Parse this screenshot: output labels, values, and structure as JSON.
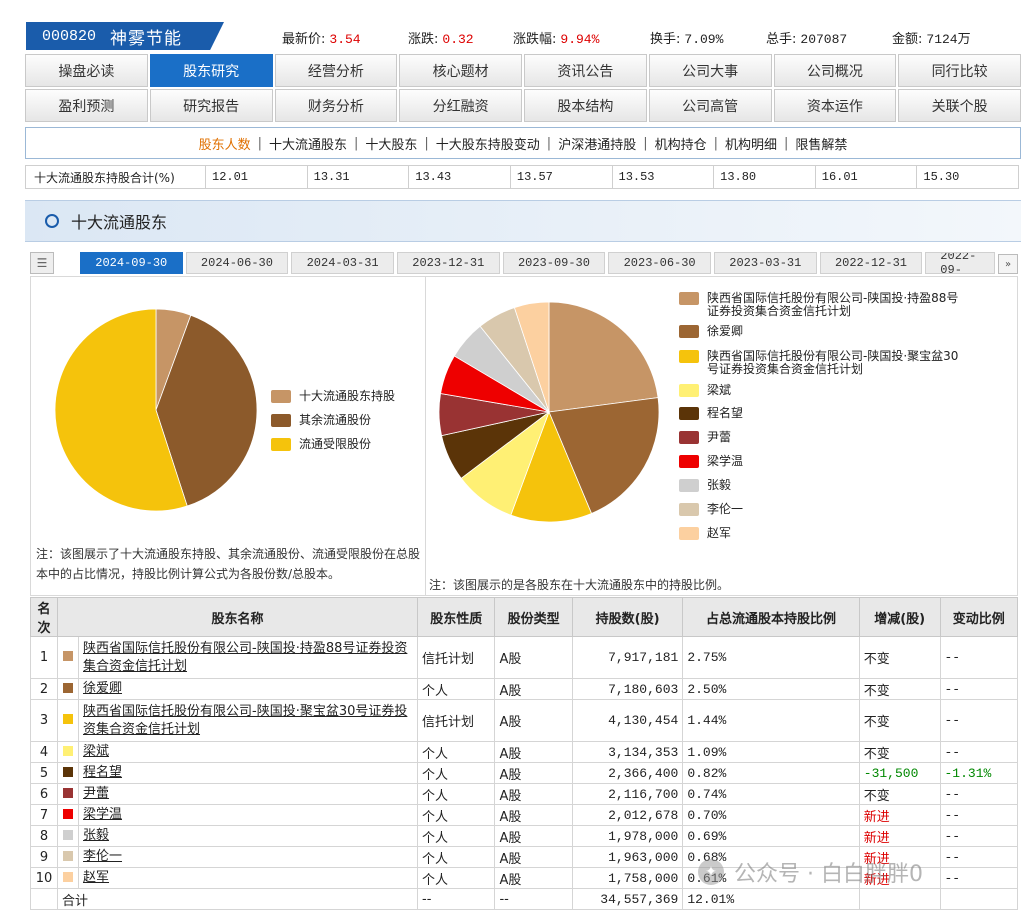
{
  "stock": {
    "code": "000820",
    "name": "神雾节能"
  },
  "quote": [
    {
      "label": "最新价:",
      "value": "3.54",
      "color": "#dd0000"
    },
    {
      "label": "涨跌:",
      "value": "0.32",
      "color": "#dd0000"
    },
    {
      "label": "涨跌幅:",
      "value": "9.94%",
      "color": "#dd0000"
    },
    {
      "label": "换手:",
      "value": "7.09%",
      "color": "#222222"
    },
    {
      "label": "总手:",
      "value": "207087",
      "color": "#222222"
    },
    {
      "label": "金额:",
      "value": "7124万",
      "color": "#222222"
    }
  ],
  "nav": {
    "items": [
      "操盘必读",
      "股东研究",
      "经营分析",
      "核心题材",
      "资讯公告",
      "公司大事",
      "公司概况",
      "同行比较",
      "盈利预测",
      "研究报告",
      "财务分析",
      "分红融资",
      "股本结构",
      "公司高管",
      "资本运作",
      "关联个股"
    ],
    "active_index": 1
  },
  "subnav": {
    "items": [
      "股东人数",
      "十大流通股东",
      "十大股东",
      "十大股东持股变动",
      "沪深港通持股",
      "机构持仓",
      "机构明细",
      "限售解禁"
    ],
    "active_index": 0,
    "separator": "|"
  },
  "summary_row": {
    "label": "十大流通股东持股合计(%)",
    "values": [
      "12.01",
      "13.31",
      "13.43",
      "13.57",
      "13.53",
      "13.80",
      "16.01",
      "15.30"
    ]
  },
  "section": {
    "title": "十大流通股东"
  },
  "date_tabs": {
    "items": [
      "2024-09-30",
      "2024-06-30",
      "2024-03-31",
      "2023-12-31",
      "2023-09-30",
      "2023-06-30",
      "2023-03-31",
      "2022-12-31",
      "2022-09-"
    ],
    "active_index": 0,
    "list_icon": "list-icon",
    "arrow_icon": "double-right-arrow-icon"
  },
  "chart_data": [
    {
      "type": "pie",
      "title": "",
      "labels": [
        "十大流通股东持股",
        "其余流通股份",
        "流通受限股份"
      ],
      "values": [
        5.6,
        39.4,
        55.0
      ],
      "colors": [
        "#c69566",
        "#8c5a2b",
        "#f5c30c"
      ]
    },
    {
      "type": "pie",
      "title": "",
      "labels": [
        "陕西省国际信托股份有限公司-陕国投·持盈88号证券投资集合资金信托计划",
        "徐爱卿",
        "陕西省国际信托股份有限公司-陕国投·聚宝盆30号证券投资集合资金信托计划",
        "梁斌",
        "程名望",
        "尹蕾",
        "梁学温",
        "张毅",
        "李伦一",
        "赵军"
      ],
      "values": [
        7917181,
        7180603,
        4130454,
        3134353,
        2366400,
        2116700,
        2012678,
        1978000,
        1963000,
        1758000
      ],
      "colors": [
        "#c69566",
        "#9c6633",
        "#f5c30c",
        "#fff074",
        "#5b3408",
        "#993333",
        "#ee0000",
        "#cfcfcf",
        "#d9c8ad",
        "#fcd0a0"
      ]
    }
  ],
  "notes": {
    "left": "注：该图展示了十大流通股东持股、其余流通股份、流通受限股份在总股本中的占比情况，持股比例计算公式为各股份数/总股本。",
    "right": "注：该图展示的是各股东在十大流通股东中的持股比例。"
  },
  "table": {
    "headers": [
      "名次",
      "股东名称",
      "股东性质",
      "股份类型",
      "持股数(股)",
      "占总流通股本持股比例",
      "增减(股)",
      "变动比例"
    ],
    "rows": [
      {
        "rank": "1",
        "name": "陕西省国际信托股份有限公司-陕国投·持盈88号证券投资集合资金信托计划",
        "nature": "信托计划",
        "type": "A股",
        "shares": "7,917,181",
        "ratio": "2.75%",
        "change": "不变",
        "change_ratio": "--",
        "color": "#c69566",
        "change_color": "#222222",
        "ratio_color": "#222222"
      },
      {
        "rank": "2",
        "name": "徐爱卿",
        "nature": "个人",
        "type": "A股",
        "shares": "7,180,603",
        "ratio": "2.50%",
        "change": "不变",
        "change_ratio": "--",
        "color": "#9c6633",
        "change_color": "#222222",
        "ratio_color": "#222222"
      },
      {
        "rank": "3",
        "name": "陕西省国际信托股份有限公司-陕国投·聚宝盆30号证券投资集合资金信托计划",
        "nature": "信托计划",
        "type": "A股",
        "shares": "4,130,454",
        "ratio": "1.44%",
        "change": "不变",
        "change_ratio": "--",
        "color": "#f5c30c",
        "change_color": "#222222",
        "ratio_color": "#222222"
      },
      {
        "rank": "4",
        "name": "梁斌",
        "nature": "个人",
        "type": "A股",
        "shares": "3,134,353",
        "ratio": "1.09%",
        "change": "不变",
        "change_ratio": "--",
        "color": "#fff074",
        "change_color": "#222222",
        "ratio_color": "#222222"
      },
      {
        "rank": "5",
        "name": "程名望",
        "nature": "个人",
        "type": "A股",
        "shares": "2,366,400",
        "ratio": "0.82%",
        "change": "-31,500",
        "change_ratio": "-1.31%",
        "color": "#5b3408",
        "change_color": "#008800",
        "ratio_color": "#008800"
      },
      {
        "rank": "6",
        "name": "尹蕾",
        "nature": "个人",
        "type": "A股",
        "shares": "2,116,700",
        "ratio": "0.74%",
        "change": "不变",
        "change_ratio": "--",
        "color": "#993333",
        "change_color": "#222222",
        "ratio_color": "#222222"
      },
      {
        "rank": "7",
        "name": "梁学温",
        "nature": "个人",
        "type": "A股",
        "shares": "2,012,678",
        "ratio": "0.70%",
        "change": "新进",
        "change_ratio": "--",
        "color": "#ee0000",
        "change_color": "#dd0000",
        "ratio_color": "#222222"
      },
      {
        "rank": "8",
        "name": "张毅",
        "nature": "个人",
        "type": "A股",
        "shares": "1,978,000",
        "ratio": "0.69%",
        "change": "新进",
        "change_ratio": "--",
        "color": "#cfcfcf",
        "change_color": "#dd0000",
        "ratio_color": "#222222"
      },
      {
        "rank": "9",
        "name": "李伦一",
        "nature": "个人",
        "type": "A股",
        "shares": "1,963,000",
        "ratio": "0.68%",
        "change": "新进",
        "change_ratio": "--",
        "color": "#d9c8ad",
        "change_color": "#dd0000",
        "ratio_color": "#222222"
      },
      {
        "rank": "10",
        "name": "赵军",
        "nature": "个人",
        "type": "A股",
        "shares": "1,758,000",
        "ratio": "0.61%",
        "change": "新进",
        "change_ratio": "--",
        "color": "#fcd0a0",
        "change_color": "#dd0000",
        "ratio_color": "#222222"
      }
    ],
    "total": {
      "label": "合计",
      "nature": "--",
      "type": "--",
      "shares": "34,557,369",
      "ratio": "12.01%"
    }
  },
  "watermark": {
    "text": "公众号 · 白白胖胖0",
    "icon": "wechat-icon"
  }
}
